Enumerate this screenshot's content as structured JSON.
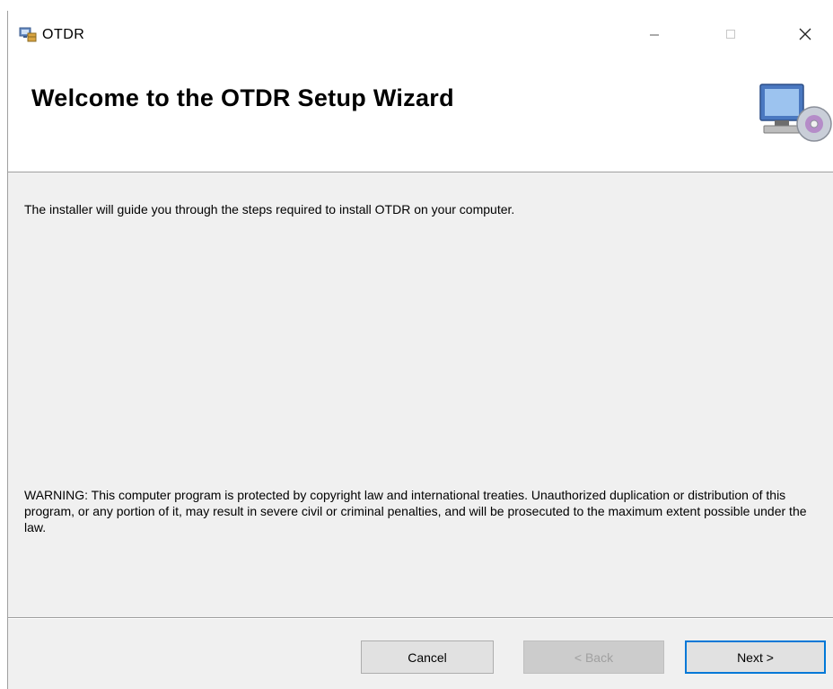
{
  "window": {
    "title": "OTDR",
    "app_icon": "installer-icon",
    "controls": {
      "minimize_icon": "minimize-icon",
      "maximize_icon": "maximize-icon",
      "close_icon": "close-icon"
    }
  },
  "banner": {
    "title": "Welcome to the OTDR Setup Wizard",
    "icon": "computer-install-icon"
  },
  "body": {
    "intro": "The installer will guide you through the steps required to install OTDR on your computer.",
    "warning": "WARNING: This computer program is protected by copyright law and international treaties. Unauthorized duplication or distribution of this program, or any portion of it, may result in severe civil or criminal penalties, and will be prosecuted to the maximum extent possible under the law."
  },
  "buttons": {
    "cancel": "Cancel",
    "back": "< Back",
    "next": "Next >",
    "back_enabled": false
  },
  "colors": {
    "accent": "#0078d7",
    "window_bg": "#f0f0f0",
    "banner_bg": "#ffffff"
  }
}
